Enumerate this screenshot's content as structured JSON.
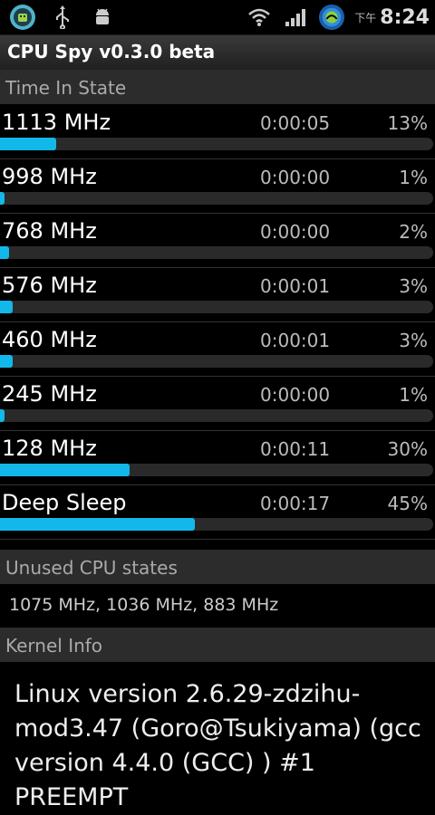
{
  "status_bar": {
    "ampm": "下午",
    "time": "8:24",
    "icons": [
      "android-robot-app-icon",
      "usb-icon",
      "android-debug-icon",
      "wifi-icon",
      "signal-icon",
      "network-globe-icon"
    ]
  },
  "app": {
    "title": "CPU Spy v0.3.0 beta"
  },
  "time_in_state": {
    "header": "Time In State",
    "states": [
      {
        "name": "1113 MHz",
        "time": "0:00:05",
        "percent": "13%",
        "fraction": 0.13
      },
      {
        "name": "998 MHz",
        "time": "0:00:00",
        "percent": "1%",
        "fraction": 0.01
      },
      {
        "name": "768 MHz",
        "time": "0:00:00",
        "percent": "2%",
        "fraction": 0.02
      },
      {
        "name": "576 MHz",
        "time": "0:00:01",
        "percent": "3%",
        "fraction": 0.03
      },
      {
        "name": "460 MHz",
        "time": "0:00:01",
        "percent": "3%",
        "fraction": 0.03
      },
      {
        "name": "245 MHz",
        "time": "0:00:00",
        "percent": "1%",
        "fraction": 0.01
      },
      {
        "name": "128 MHz",
        "time": "0:00:11",
        "percent": "30%",
        "fraction": 0.3
      },
      {
        "name": "Deep Sleep",
        "time": "0:00:17",
        "percent": "45%",
        "fraction": 0.45
      }
    ]
  },
  "unused": {
    "header": "Unused CPU states",
    "value": "1075 MHz, 1036 MHz, 883 MHz"
  },
  "kernel": {
    "header": "Kernel Info",
    "text": "Linux version 2.6.29-zdzihu-mod3.47 (Goro@Tsukiyama) (gcc version 4.4.0 (GCC) ) #1 PREEMPT"
  },
  "colors": {
    "bar_fill": "#13b8ea",
    "bar_track": "#2a2a2a",
    "section_header": "#2c2c2c"
  }
}
